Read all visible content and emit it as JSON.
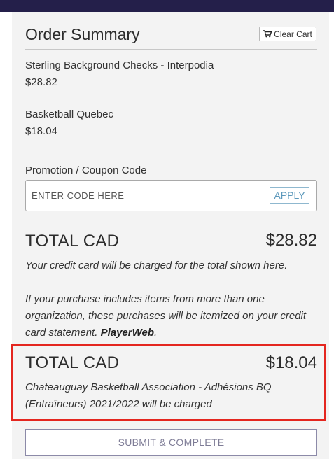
{
  "order_summary": {
    "title": "Order Summary",
    "clear_cart_label": "Clear Cart",
    "items": [
      {
        "name": "Sterling Background Checks - Interpodia",
        "price": "$28.82"
      },
      {
        "name": "Basketball Quebec",
        "price": "$18.04"
      }
    ],
    "promo": {
      "label": "Promotion / Coupon Code",
      "placeholder": "ENTER CODE HERE",
      "value": "",
      "apply_label": "APPLY"
    },
    "total_primary": {
      "label": "TOTAL CAD",
      "amount": "$28.82",
      "note": "Your credit card will be charged for the total shown here."
    },
    "itemized_note": {
      "text": "If your purchase includes items from more than one organization, these purchases will be itemized on your credit card statement. ",
      "brand": "PlayerWeb",
      "suffix": "."
    },
    "total_secondary": {
      "label": "TOTAL CAD",
      "amount": "$18.04",
      "note": "Chateauguay Basketball Association - Adhésions BQ (Entraîneurs) 2021/2022 will be charged"
    },
    "submit_label": "SUBMIT & COMPLETE",
    "colors": {
      "topbar": "#241f4a",
      "panel": "#f3f3f3",
      "highlight": "#e4261f",
      "apply": "#5b98bb"
    },
    "icons": {
      "cart": "shopping-cart-icon"
    }
  }
}
